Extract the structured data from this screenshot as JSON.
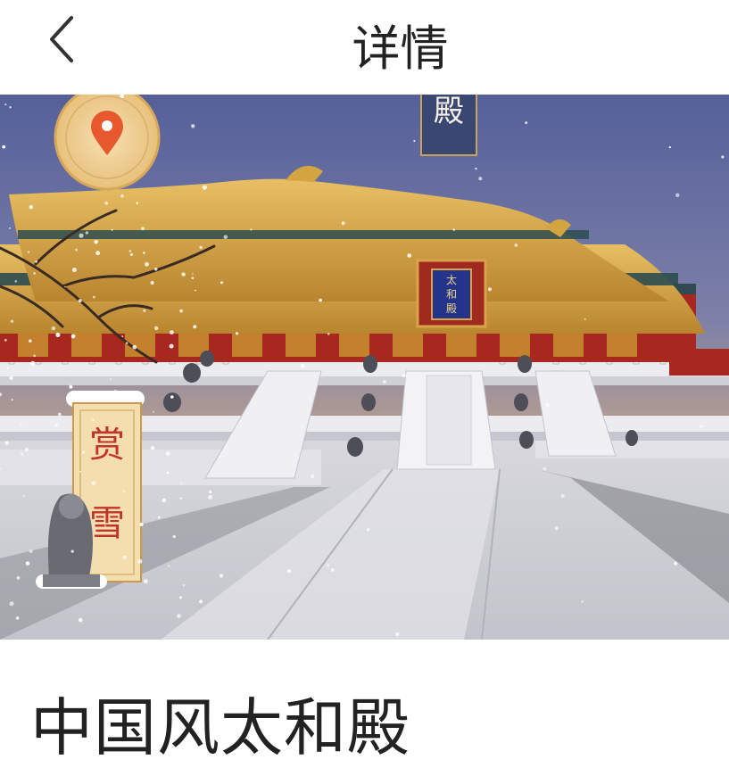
{
  "header": {
    "title": "详情",
    "back_icon": "chevron-left-icon"
  },
  "hero": {
    "top_plaque_char": "殿",
    "hall_plaque_text": "太和殿",
    "snow_label": [
      "赏",
      "雪"
    ],
    "location_icon": "location-pin-icon"
  },
  "content": {
    "title": "中国风太和殿"
  },
  "colors": {
    "roof": "#d9a94e",
    "wall": "#b02b22",
    "sky": "#5f6aa0",
    "accent": "#e8582f"
  }
}
